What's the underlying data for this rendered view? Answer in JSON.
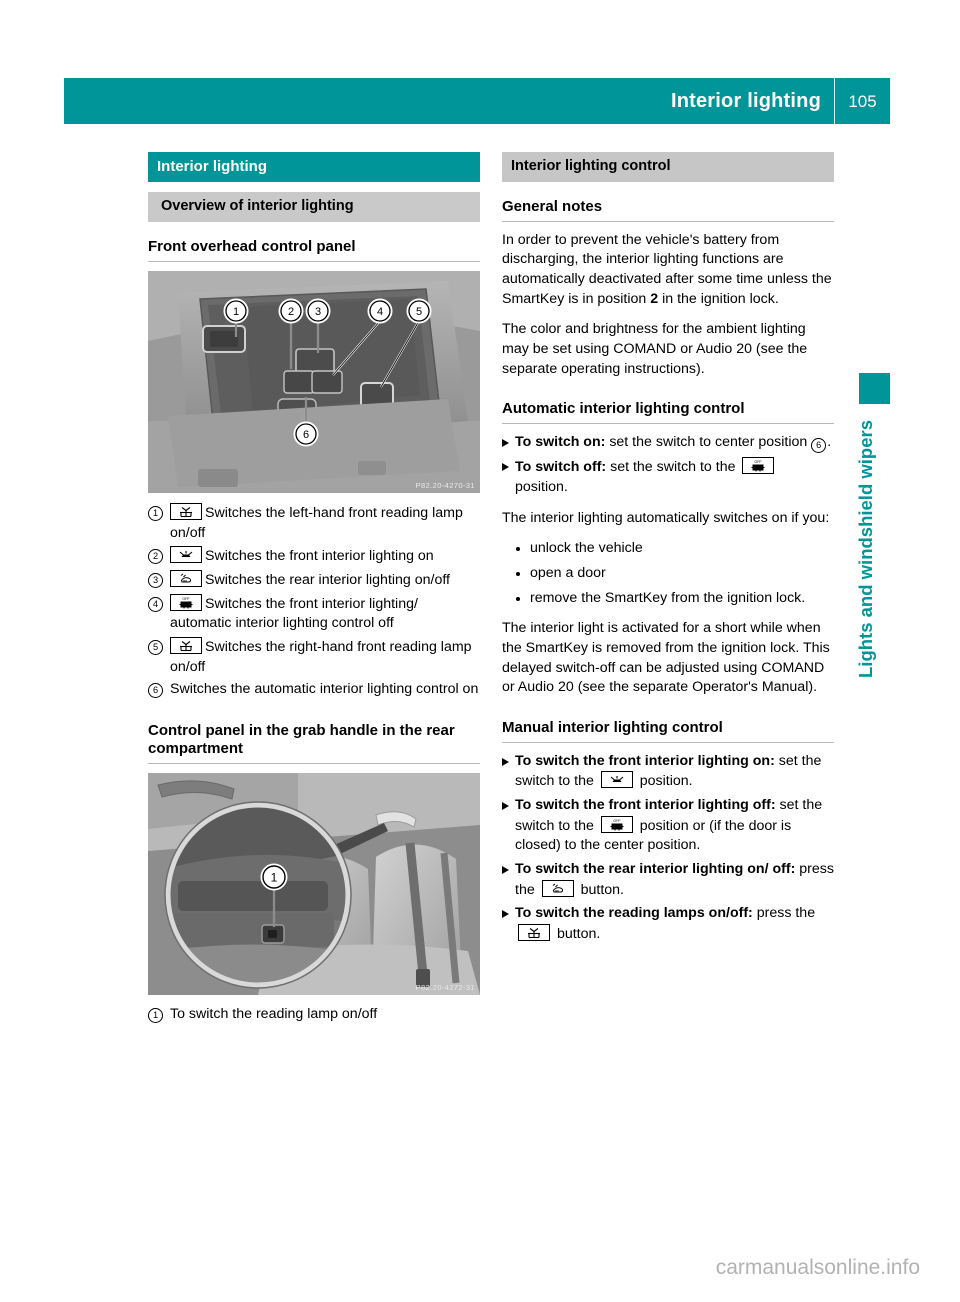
{
  "header": {
    "title": "Interior lighting",
    "page_number": "105",
    "accent_color": "#009699"
  },
  "side_tab": {
    "label": "Lights and windshield wipers",
    "color": "#009699"
  },
  "left_column": {
    "section_banner": "Interior lighting",
    "subsection_banner": "Overview of interior lighting",
    "heading_1": "Front overhead control panel",
    "figure_1_code": "P82.20-4270-31",
    "legend": [
      {
        "num": "1",
        "icon": "reading-lamp-icon",
        "has_icon": true,
        "text": "Switches the left-hand front reading lamp on/off"
      },
      {
        "num": "2",
        "icon": "interior-light-on-icon",
        "has_icon": true,
        "text": "Switches the front interior lighting on"
      },
      {
        "num": "3",
        "icon": "rear-interior-light-icon",
        "has_icon": true,
        "text": "Switches the rear interior lighting on/off"
      },
      {
        "num": "4",
        "icon": "interior-light-off-icon",
        "has_icon": true,
        "text": "Switches the front interior lighting/ automatic interior lighting control off"
      },
      {
        "num": "5",
        "icon": "reading-lamp-icon",
        "has_icon": true,
        "text": "Switches the right-hand front reading lamp on/off"
      },
      {
        "num": "6",
        "icon": "",
        "has_icon": false,
        "text": "Switches the automatic interior lighting control on"
      }
    ],
    "heading_2": "Control panel in the grab handle in the rear compartment",
    "figure_2_code": "P82.20-4272-31",
    "legend_2": [
      {
        "num": "1",
        "icon": "",
        "has_icon": false,
        "text": "To switch the reading lamp on/off"
      }
    ]
  },
  "right_column": {
    "section_banner": "Interior lighting control",
    "heading_general": "General notes",
    "para_1_a": "In order to prevent the vehicle's battery from discharging, the interior lighting functions are automatically deactivated after some time unless the SmartKey is in position ",
    "para_1_bold": "2",
    "para_1_b": " in the ignition lock.",
    "para_2": "The color and brightness for the ambient lighting may be set using COMAND or Audio 20 (see the separate operating instructions).",
    "heading_auto": "Automatic interior lighting control",
    "auto_steps": [
      {
        "bold": "To switch on:",
        "rest_a": " set the switch to center position ",
        "circle": "6",
        "rest_b": ".",
        "icon": ""
      },
      {
        "bold": "To switch off:",
        "rest_a": " set the switch to the ",
        "icon": "interior-light-off-icon",
        "rest_b": " position."
      }
    ],
    "para_3": "The interior lighting automatically switches on if you:",
    "bullets": [
      "unlock the vehicle",
      "open a door",
      "remove the SmartKey from the ignition lock."
    ],
    "para_4": "The interior light is activated for a short while when the SmartKey is removed from the ignition lock. This delayed switch-off can be adjusted using COMAND or Audio 20 (see the separate Operator's Manual).",
    "heading_manual": "Manual interior lighting control",
    "manual_steps": [
      {
        "bold": "To switch the front interior lighting on:",
        "rest_a": " set the switch to the ",
        "icon": "interior-light-on-icon",
        "rest_b": " position."
      },
      {
        "bold": "To switch the front interior lighting off:",
        "rest_a": " set the switch to the ",
        "icon": "interior-light-off-icon",
        "rest_b": " position or (if the door is closed) to the center position."
      },
      {
        "bold": "To switch the rear interior lighting on/ off:",
        "rest_a": " press the ",
        "icon": "rear-interior-light-icon",
        "rest_b": " button."
      },
      {
        "bold": "To switch the reading lamps on/off:",
        "rest_a": " press the ",
        "icon": "reading-lamp-icon",
        "rest_b": " button."
      }
    ]
  },
  "footer": {
    "watermark": "carmanualsonline.info"
  }
}
